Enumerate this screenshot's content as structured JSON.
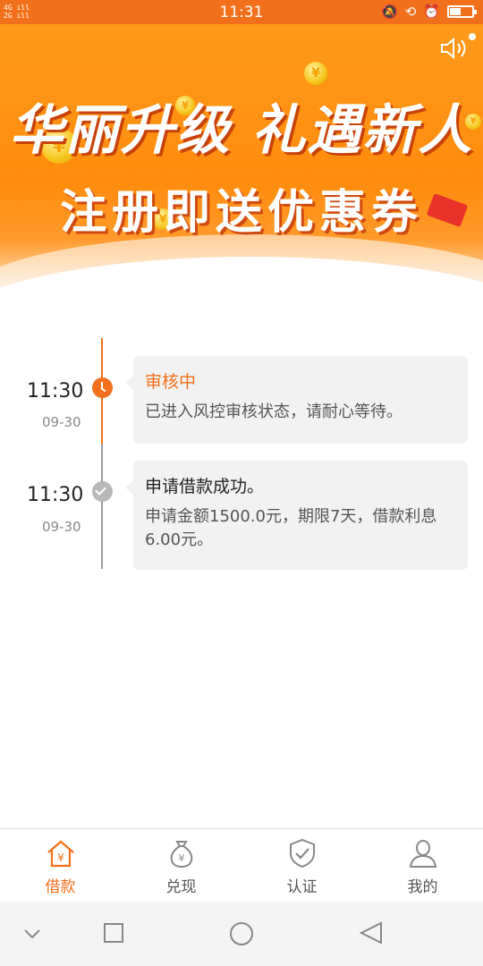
{
  "status_bar": {
    "network_1": "4G",
    "network_2": "2G",
    "time": "11:31",
    "icons": [
      "bell-mute-icon",
      "lock-rotate-icon",
      "alarm-icon",
      "battery-icon"
    ],
    "battery_level": 0.5
  },
  "banner": {
    "line1": "华丽升级 礼遇新人",
    "line2": "注册即送优惠券",
    "sound_icon": "speaker-icon",
    "page_index": 1,
    "page_count": 1,
    "colors": {
      "orange": "#ff8c0d",
      "shadow": "#c8430a"
    }
  },
  "timeline": [
    {
      "time": "11:30",
      "date": "09-30",
      "title": "审核中",
      "description": "已进入风控审核状态，请耐心等待。",
      "state": "active"
    },
    {
      "time": "11:30",
      "date": "09-30",
      "title": "申请借款成功。",
      "description": "申请金额1500.0元，期限7天，借款利息6.00元。",
      "state": "done"
    }
  ],
  "bottom_nav": [
    {
      "label": "借款",
      "icon": "house-yen-icon",
      "active": true
    },
    {
      "label": "兑现",
      "icon": "money-bag-icon",
      "active": false
    },
    {
      "label": "认证",
      "icon": "shield-check-icon",
      "active": false
    },
    {
      "label": "我的",
      "icon": "person-icon",
      "active": false
    }
  ],
  "system_nav": [
    "chevron-down-icon",
    "recents-square-icon",
    "home-circle-icon",
    "back-triangle-icon"
  ],
  "colors": {
    "accent": "#f2701b",
    "card_bg": "#f2f2f2",
    "muted": "#888888"
  }
}
